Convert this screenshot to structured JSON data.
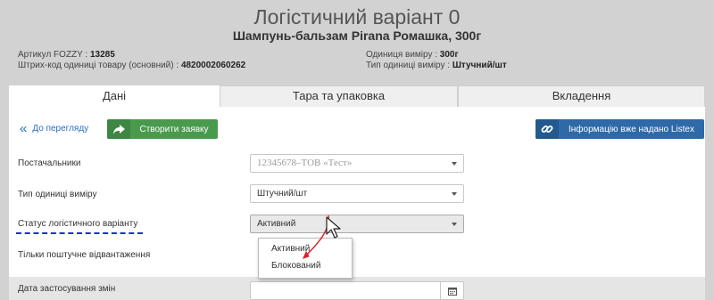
{
  "header": {
    "title": "Логістичний варіант 0",
    "subtitle": "Шампунь-бальзам Pirana Ромашка, 300г",
    "left_info": [
      {
        "label": "Артикул FOZZY : ",
        "value": "13285"
      },
      {
        "label": "Штрих-код одиниці товару (основний) : ",
        "value": "4820002060262"
      }
    ],
    "right_info": [
      {
        "label": "Одиниця виміру : ",
        "value": "300г"
      },
      {
        "label": "Тип одиниці виміру : ",
        "value": "Штучний/шт"
      }
    ]
  },
  "tabs": [
    {
      "label": "Дані",
      "active": true
    },
    {
      "label": "Тара та упаковка",
      "active": false
    },
    {
      "label": "Вкладення",
      "active": false
    }
  ],
  "toolbar": {
    "back_label": "До перегляду",
    "create_request_label": "Створити заявку",
    "listex_label": "Інформацію вже надано Listex"
  },
  "form": {
    "suppliers_label": "Постачальники",
    "suppliers_value": "12345678–ТОВ «Тест»",
    "unit_type_label": "Тип одиниці виміру",
    "unit_type_value": "Штучний/шт",
    "status_label": "Статус логістичного варіанту",
    "status_value": "Активний",
    "status_options": [
      "Активний",
      "Блокований"
    ],
    "only_piece_label": "Тільки поштучне відвантаження",
    "apply_date_label": "Дата застосування змін",
    "apply_date_value": ""
  }
}
